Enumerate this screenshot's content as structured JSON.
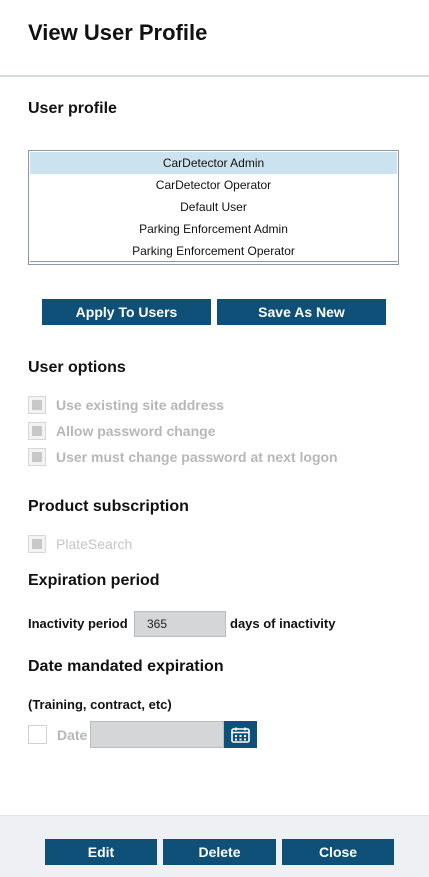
{
  "header": {
    "title": "View User Profile"
  },
  "user_profile": {
    "heading": "User profile",
    "items": [
      {
        "label": "CarDetector Admin",
        "selected": true
      },
      {
        "label": "CarDetector Operator",
        "selected": false
      },
      {
        "label": "Default User",
        "selected": false
      },
      {
        "label": "Parking Enforcement Admin",
        "selected": false
      },
      {
        "label": "Parking Enforcement Operator",
        "selected": false
      }
    ],
    "apply_label": "Apply To Users",
    "save_as_new_label": "Save As New"
  },
  "user_options": {
    "heading": "User options",
    "items": [
      {
        "label": "Use existing site address",
        "checked": false,
        "disabled": true
      },
      {
        "label": "Allow password change",
        "checked": false,
        "disabled": true
      },
      {
        "label": "User must change password at next logon",
        "checked": false,
        "disabled": true
      }
    ]
  },
  "product_subscription": {
    "heading": "Product subscription",
    "items": [
      {
        "label": "PlateSearch",
        "checked": false,
        "disabled": true
      }
    ]
  },
  "expiration": {
    "heading": "Expiration period",
    "inactivity_label": "Inactivity period",
    "inactivity_value": "365",
    "inactivity_suffix": "days of inactivity"
  },
  "date_mandated": {
    "heading": "Date mandated expiration",
    "note": "(Training, contract, etc)",
    "date_label": "Date",
    "date_value": "",
    "calendar_icon": "calendar-icon"
  },
  "footer": {
    "edit_label": "Edit",
    "delete_label": "Delete",
    "close_label": "Close"
  },
  "colors": {
    "primary_button": "#0e5078",
    "selected_row": "#cce3ef",
    "footer_bg": "#eef0f3"
  }
}
